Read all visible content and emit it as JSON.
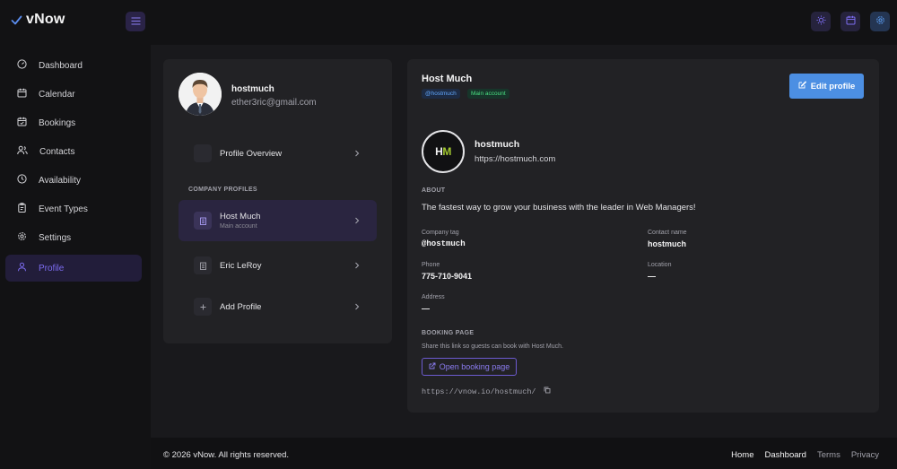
{
  "app": {
    "name": "vNow"
  },
  "icons": {
    "brand": "check-icon",
    "menu": "hamburger-menu-icon",
    "theme": "sun-icon",
    "calendar": "calendar-icon",
    "settings": "gear-icon"
  },
  "colors": {
    "accent": "#7c6cf0",
    "primary_button": "#4c8fe3",
    "tag_badge": "#60a5fa",
    "main_badge": "#4ade80",
    "logo_green": "#a3c930"
  },
  "sidebar": {
    "items": [
      {
        "label": "Dashboard",
        "icon": "speedometer-icon",
        "active": false
      },
      {
        "label": "Calendar",
        "icon": "calendar-icon",
        "active": false
      },
      {
        "label": "Bookings",
        "icon": "calendar-check-icon",
        "active": false
      },
      {
        "label": "Contacts",
        "icon": "people-icon",
        "active": false
      },
      {
        "label": "Availability",
        "icon": "clock-icon",
        "active": false
      },
      {
        "label": "Event Types",
        "icon": "clipboard-icon",
        "active": false
      },
      {
        "label": "Settings",
        "icon": "gear-icon",
        "active": false
      },
      {
        "label": "Profile",
        "icon": "user-icon",
        "active": true
      }
    ]
  },
  "profile_panel": {
    "user_name": "hostmuch",
    "user_email": "ether3ric@gmail.com",
    "overview_label": "Profile Overview",
    "section_label": "COMPANY PROFILES",
    "companies": [
      {
        "label": "Host Much",
        "sub": "Main account",
        "active": true
      },
      {
        "label": "Eric LeRoy",
        "sub": "",
        "active": false
      }
    ],
    "add_label": "Add Profile"
  },
  "company": {
    "title": "Host Much",
    "tag_badge": "@hostmuch",
    "main_badge": "Main account",
    "edit_button": "Edit profile",
    "logo_initials_h": "H",
    "logo_initials_m": "M",
    "name": "hostmuch",
    "url": "https://hostmuch.com",
    "about_label": "ABOUT",
    "about_text": "The fastest way to grow your business with the leader in Web Managers!",
    "company_tag_label": "Company tag",
    "company_tag_value": "@hostmuch",
    "contact_name_label": "Contact name",
    "contact_name_value": "hostmuch",
    "phone_label": "Phone",
    "phone_value": "775-710-9041",
    "location_label": "Location",
    "location_value": "—",
    "address_label": "Address",
    "address_value": "—",
    "booking_label": "BOOKING PAGE",
    "booking_desc": "Share this link so guests can book with Host Much.",
    "open_booking_button": "Open booking page",
    "booking_url": "https://vnow.io/hostmuch/"
  },
  "footer": {
    "copyright": "© 2026 vNow. All rights reserved.",
    "links": [
      {
        "label": "Home",
        "color": "#f4f4f5"
      },
      {
        "label": "Dashboard",
        "color": "#f4f4f5"
      },
      {
        "label": "Terms",
        "color": "#a1a1aa"
      },
      {
        "label": "Privacy",
        "color": "#a1a1aa"
      }
    ]
  }
}
